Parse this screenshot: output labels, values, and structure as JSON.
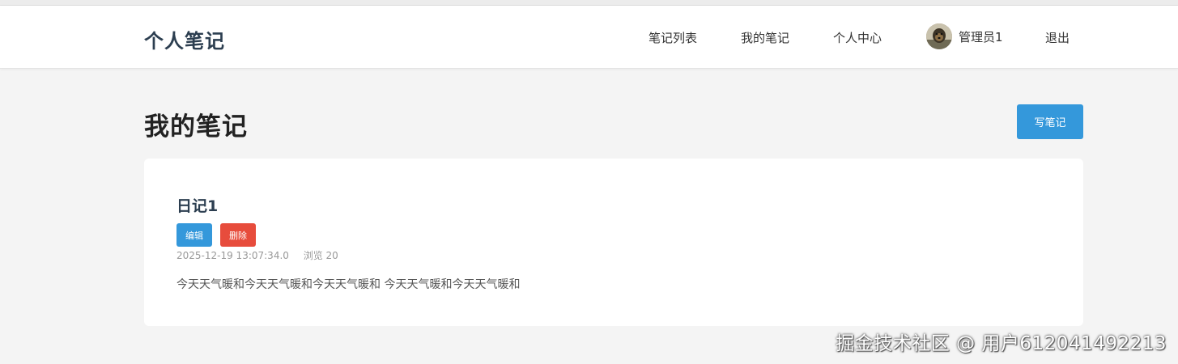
{
  "navbar": {
    "brand": "个人笔记",
    "links": {
      "note_list": "笔记列表",
      "my_notes": "我的笔记",
      "user_center": "个人中心",
      "logout": "退出"
    },
    "user": {
      "name": "管理员1",
      "avatar_icon": "avatar-photo-icon"
    }
  },
  "main": {
    "title": "我的笔记",
    "write_button": "写笔记"
  },
  "notes": [
    {
      "title": "日记1",
      "edit_label": "编辑",
      "delete_label": "删除",
      "datetime": "2025-12-19 13:07:34.0",
      "views": "浏览 20",
      "content": "今天天气暖和今天天气暖和今天天气暖和 今天天气暖和今天天气暖和"
    }
  ],
  "watermark": "掘金技术社区 @ 用户612041492213",
  "colors": {
    "primary": "#3498db",
    "danger": "#e74c3c",
    "brand_text": "#2c3e50",
    "background": "#f4f4f4"
  }
}
